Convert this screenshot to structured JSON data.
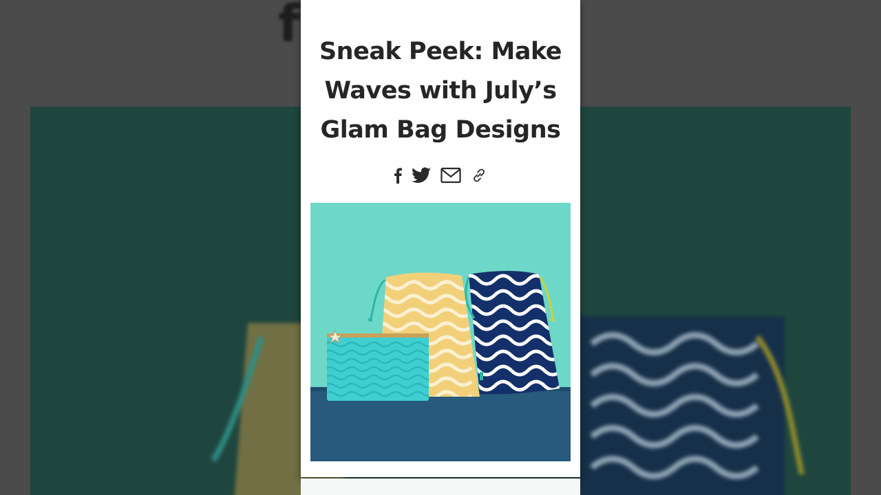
{
  "article": {
    "title": "Sneak Peek: Make Waves with July’s Glam Bag Designs"
  },
  "share": {
    "icons": [
      "facebook-icon",
      "twitter-icon",
      "email-icon",
      "link-icon"
    ]
  },
  "hero_image": {
    "subject": "three glam bags with wave patterns",
    "colors": {
      "backdrop": "#6dd8c8",
      "floor": "#275a7c",
      "pouch": "#3fcfd0",
      "yellow_bag": "#f2d07a",
      "navy_bag": "#14306a",
      "accent_cord": "#c8d33a"
    }
  }
}
